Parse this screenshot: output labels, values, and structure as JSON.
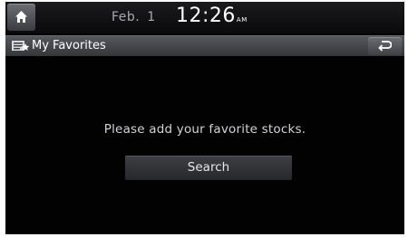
{
  "status_bar": {
    "date_month": "Feb.",
    "date_day": "1",
    "time": "12:26",
    "ampm": "AM"
  },
  "title_bar": {
    "title": "My Favorites"
  },
  "main": {
    "message": "Please add your favorite stocks.",
    "search_button_label": "Search"
  },
  "icons": {
    "home": "home-icon",
    "favorites": "favorites-icon",
    "back": "back-icon"
  }
}
